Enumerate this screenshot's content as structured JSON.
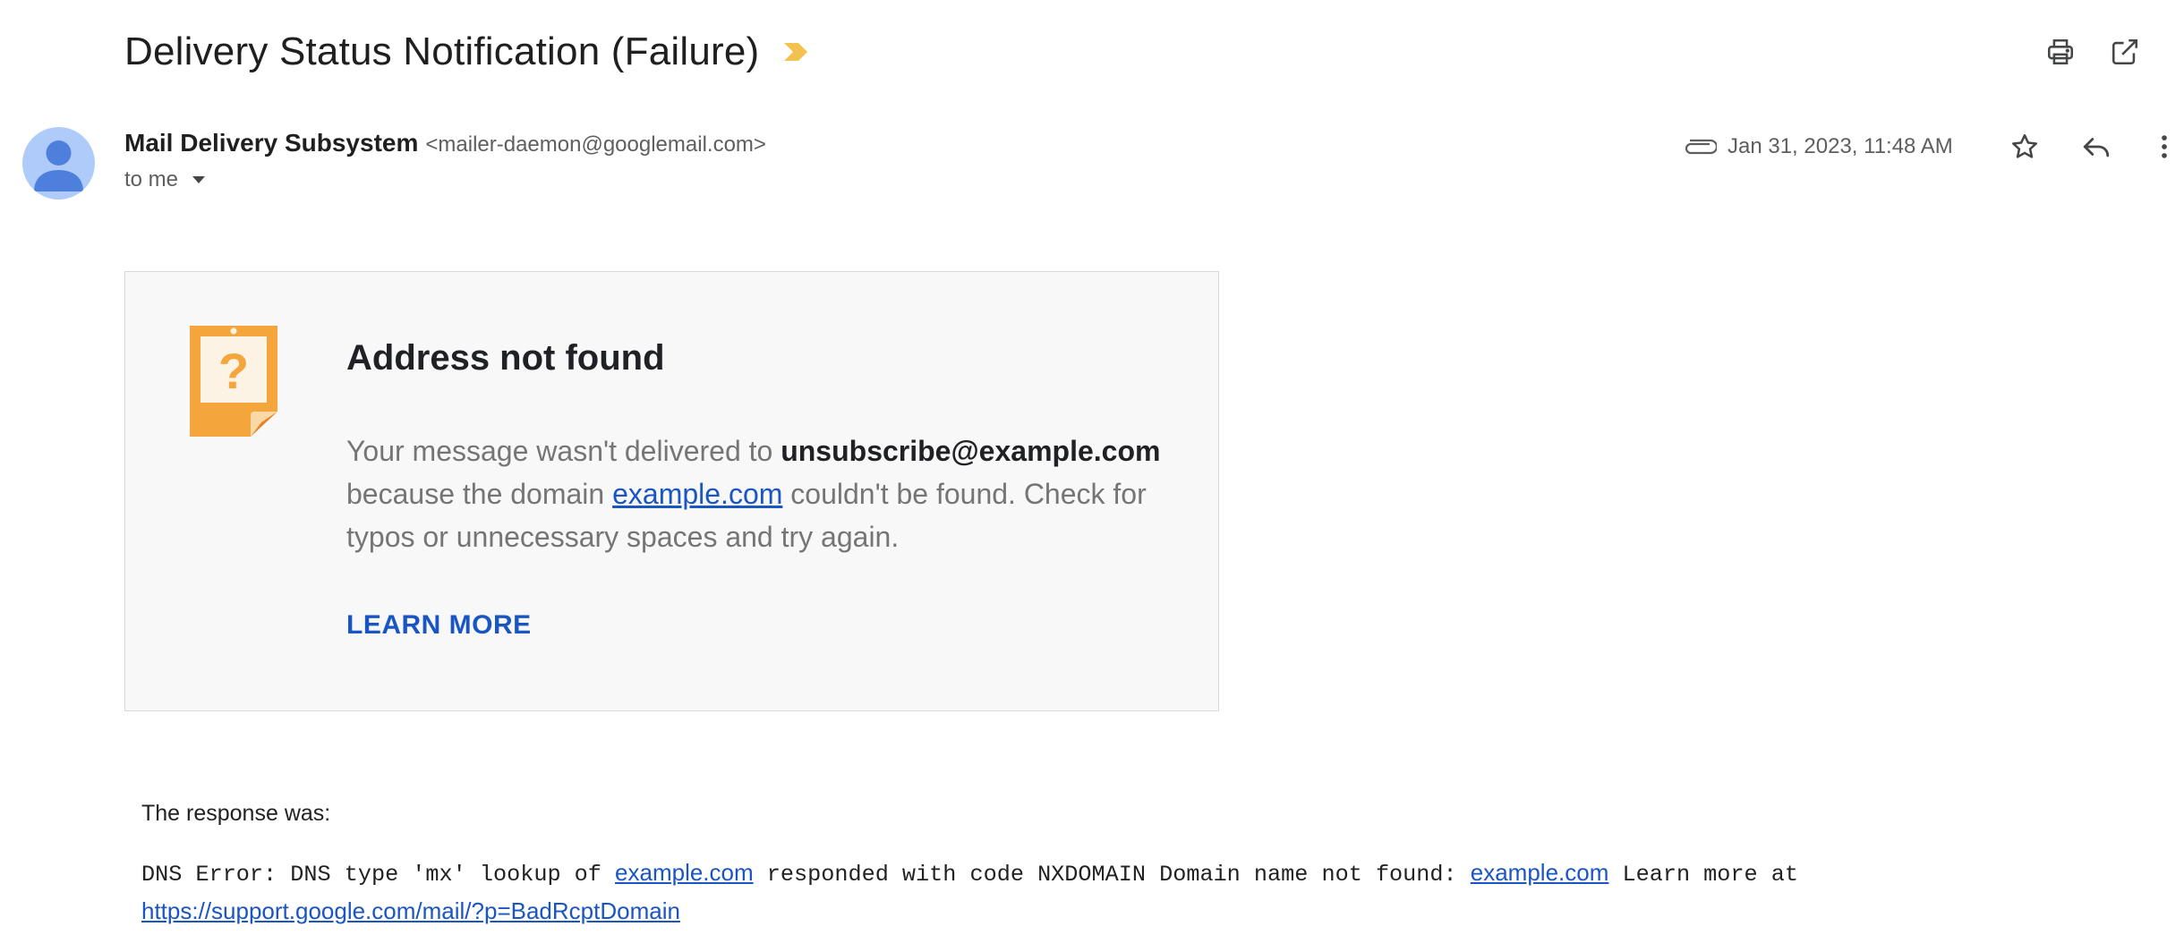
{
  "header": {
    "subject": "Delivery Status Notification (Failure)",
    "importance_marker_color": "#f2c14e",
    "actions": [
      {
        "name": "print-icon",
        "label": "Print all"
      },
      {
        "name": "open-in-new-window-icon",
        "label": "In new window"
      }
    ]
  },
  "message": {
    "sender_name": "Mail Delivery Subsystem",
    "sender_email": "<mailer-daemon@googlemail.com>",
    "recipient": "to me",
    "date": "Jan 31, 2023, 11:48 AM",
    "icons": [
      "attachment-icon",
      "star-icon",
      "reply-icon",
      "more-vert-icon"
    ]
  },
  "card": {
    "title": "Address not found",
    "text_1": "Your message wasn't delivered to ",
    "recipient_address": "unsubscribe@example.com",
    "text_2": "because the domain ",
    "domain_link": "example.com",
    "text_3": " couldn't be found. Check for typos or unnecessary spaces and try again.",
    "learn_more": "LEARN MORE",
    "icon_color": "#f4a63d"
  },
  "response": {
    "label": "The response was:",
    "part_1": "DNS Error: DNS type 'mx' lookup of ",
    "link_1": "example.com",
    "part_2": " responded with code NXDOMAIN Domain name not found: ",
    "link_2": "example.com",
    "part_3": " Learn more at ",
    "link_3": "https://support.google.com/mail/?p=BadRcptDomain"
  },
  "colors": {
    "link": "#1a55c4",
    "avatar_bg": "#aecbfa",
    "avatar_fg": "#4f7fdd"
  }
}
